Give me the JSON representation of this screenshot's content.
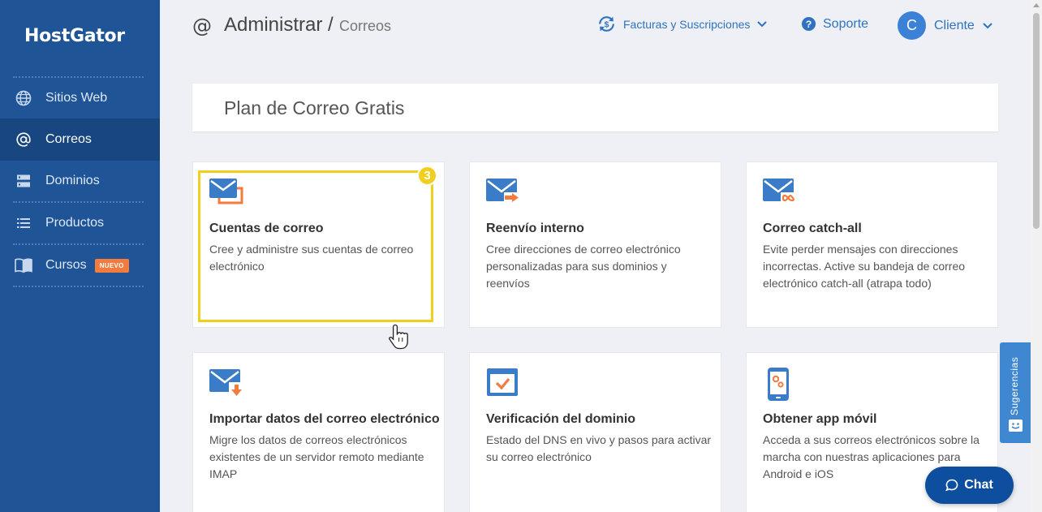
{
  "sidebar": {
    "logo": "HostGator",
    "items": [
      {
        "label": "Sitios Web",
        "icon": "globe-icon"
      },
      {
        "label": "Correos",
        "icon": "at-icon",
        "active": true
      },
      {
        "label": "Dominios",
        "icon": "server-icon"
      },
      {
        "label": "Productos",
        "icon": "list-icon"
      },
      {
        "label": "Cursos",
        "icon": "book-icon",
        "badge": "NUEVO"
      }
    ]
  },
  "header": {
    "breadcrumb_icon": "@",
    "breadcrumb_main": "Administrar /",
    "breadcrumb_current": "Correos",
    "billing_label": "Facturas y Suscripciones",
    "support_label": "Soporte",
    "client_initial": "C",
    "client_label": "Cliente"
  },
  "plan": {
    "title": "Plan de Correo Gratis"
  },
  "cards": [
    {
      "title": "Cuentas de correo",
      "description": "Cree y administre sus cuentas de correo electrónico",
      "icon": "mail-accounts-icon"
    },
    {
      "title": "Reenvío interno",
      "description": "Cree direcciones de correo electrónico personalizadas para sus dominios y reenvíos",
      "icon": "mail-forward-icon"
    },
    {
      "title": "Correo catch-all",
      "description": "Evite perder mensajes con direcciones incorrectas. Active su bandeja de correo electrónico catch-all (atrapa todo)",
      "icon": "mail-catchall-icon"
    },
    {
      "title": "Importar datos del correo electrónico",
      "description": "Migre los datos de correos electrónicos existentes de un servidor remoto mediante IMAP",
      "icon": "mail-import-icon"
    },
    {
      "title": "Verificación del dominio",
      "description": "Estado del DNS en vivo y pasos para activar su correo electrónico",
      "icon": "domain-check-icon"
    },
    {
      "title": "Obtener app móvil",
      "description": "Acceda a sus correos electrónicos sobre la marcha con nuestras aplicaciones para Android e iOS",
      "icon": "mobile-app-icon"
    }
  ],
  "step_badge": "3",
  "suggestions_label": "Sugerencias",
  "chat_label": "Chat",
  "colors": {
    "sidebar": "#1f5497",
    "accent": "#2f73c0",
    "highlight": "#f2cf1e",
    "badge": "#f27b3d",
    "chat": "#0e4e9f"
  }
}
